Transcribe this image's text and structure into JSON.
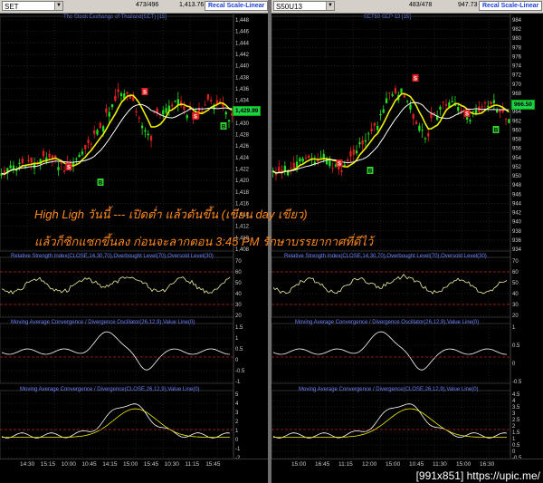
{
  "left": {
    "symbol": "SET",
    "count": "473/496",
    "value": "1,413.76",
    "recal": "Recal Scale-Linear",
    "title": "The Stock Exchange of Thailand(SET) [15]",
    "price_box": "1,429.99",
    "y_ticks": [
      "1,448",
      "1,446",
      "1,444",
      "1,442",
      "1,440",
      "1,438",
      "1,436",
      "1,434",
      "1,432",
      "1,430",
      "1,428",
      "1,426",
      "1,424",
      "1,422",
      "1,420",
      "1,418",
      "1,416",
      "1,414",
      "1,412",
      "1,410",
      "1,408"
    ],
    "rsi_title": "Relative Strength Index(CLOSE,14,30,70),Overbought Level(70),Oversold Level(30)",
    "rsi_ticks": [
      "70",
      "60",
      "50",
      "40",
      "30",
      "20"
    ],
    "osc_title": "Moving Average Convergence / Divergence Oscillator(26,12,9),Value Line(0)",
    "osc_ticks": [
      "1.5",
      "1",
      "0.5",
      "0",
      "-0.5",
      "-1"
    ],
    "macd_title": "Moving Average Convergence / Divergence(CLOSE,26,12,9),Value Line(0)",
    "macd_ticks": [
      "5",
      "4",
      "3",
      "2",
      "1",
      "0",
      "-1",
      "-2"
    ],
    "time_ticks": [
      "14:30",
      "15:15",
      "10:00",
      "10:45",
      "14:15",
      "15:00",
      "15:45",
      "10:30",
      "11:15",
      "15:45"
    ]
  },
  "right": {
    "symbol": "S50U13",
    "count": "483/478",
    "value": "947.73",
    "recal": "Recal Scale-Linear",
    "title": "SET50 SEP 13  [15]",
    "price_box": "966.50",
    "y_ticks": [
      "984",
      "982",
      "980",
      "978",
      "976",
      "974",
      "972",
      "970",
      "968",
      "966",
      "964",
      "962",
      "960",
      "958",
      "956",
      "954",
      "952",
      "950",
      "948",
      "946",
      "944",
      "942",
      "940",
      "938",
      "936",
      "934"
    ],
    "rsi_title": "Relative Strength Index(CLOSE,14,30,70),Overbought Level(70),Oversold Level(30)",
    "rsi_ticks": [
      "70",
      "60",
      "50",
      "40",
      "30",
      "20"
    ],
    "osc_title": "Moving Average Convergence / Divergence Oscillator(26,12,9),Value Line(0)",
    "osc_ticks": [
      "1",
      "0.5",
      "0",
      "-0.5"
    ],
    "macd_title": "Moving Average Convergence / Divergence(CLOSE,26,12,9),Value Line(0)",
    "macd_ticks": [
      "4.5",
      "4",
      "3.5",
      "3",
      "2.5",
      "2",
      "1.5",
      "1",
      "0.5",
      "0",
      "-0.5"
    ],
    "time_ticks": [
      "15:00",
      "16:45",
      "11:15",
      "12:00",
      "15:00",
      "10:45",
      "11:30",
      "15:00",
      "16:30"
    ]
  },
  "signals": {
    "sell": "S",
    "buy": "B"
  },
  "annotation": {
    "line1": "High Ligh วันนี้ --- เปิดต่ำ แล้วดันขึ้น (เขียน day เขียว)",
    "line2": "แล้วก็ซิกแซกขึ้นลง ก่อนจะลากตอน 3:45 PM รักษาบรรยากาศที่ดีไว้"
  },
  "watermark": "[991x851] https://upic.me/",
  "colors": {
    "up_candle": "#20e020",
    "down_candle": "#e02020",
    "ma_fast": "#f0f000",
    "ma_slow": "#ffffff",
    "grid": "#3a3a3a",
    "dashed_level": "#c02020",
    "title_blue": "#6f84ff",
    "annotation": "#ff8a1e",
    "buy_badge": "#30d030",
    "sell_badge": "#e02020"
  }
}
